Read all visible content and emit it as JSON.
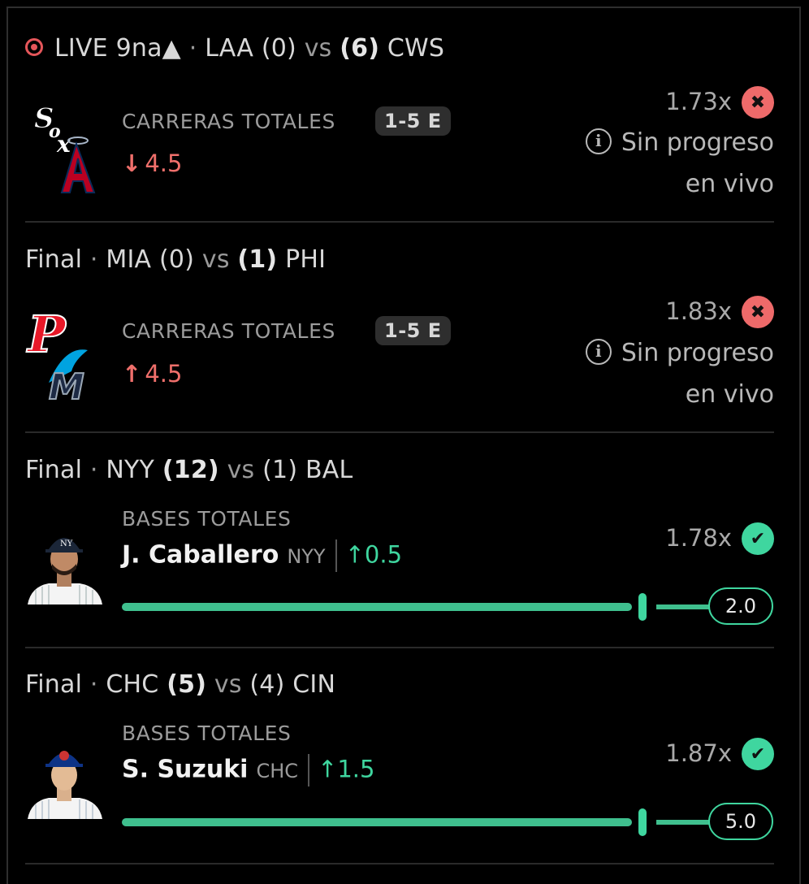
{
  "bets": [
    {
      "status_label": "LIVE 9na▲",
      "sep": "·",
      "away_team": "LAA",
      "away_score": "(0)",
      "vs": "vs",
      "home_score": "(6)",
      "home_team": "CWS",
      "market": "CARRERAS TOTALES",
      "badge": "1-5 E",
      "pick_arrow": "↓",
      "pick_value": "4.5",
      "multiplier": "1.73x",
      "result": "lost",
      "info_line1": "Sin progreso",
      "info_line2": "en vivo",
      "logos": [
        "white-sox-logo",
        "angels-logo"
      ]
    },
    {
      "status_label": "Final",
      "sep": "·",
      "away_team": "MIA",
      "away_score": "(0)",
      "vs": "vs",
      "home_score": "(1)",
      "home_team": "PHI",
      "market": "CARRERAS TOTALES",
      "badge": "1-5 E",
      "pick_arrow": "↑",
      "pick_value": "4.5",
      "multiplier": "1.83x",
      "result": "lost",
      "info_line1": "Sin progreso",
      "info_line2": "en vivo",
      "logos": [
        "phillies-logo",
        "marlins-logo"
      ]
    },
    {
      "status_label": "Final",
      "sep": "·",
      "away_team": "NYY",
      "away_score": "(12)",
      "vs": "vs",
      "home_score": "(1)",
      "home_team": "BAL",
      "market": "BASES TOTALES",
      "player": "J. Caballero",
      "player_team": "NYY",
      "pick_arrow": "↑",
      "pick_value": "0.5",
      "multiplier": "1.78x",
      "result": "won",
      "progress_value": "2.0"
    },
    {
      "status_label": "Final",
      "sep": "·",
      "away_team": "CHC",
      "away_score": "(5)",
      "vs": "vs",
      "home_score": "(4)",
      "home_team": "CIN",
      "market": "BASES TOTALES",
      "player": "S. Suzuki",
      "player_team": "CHC",
      "pick_arrow": "↑",
      "pick_value": "1.5",
      "multiplier": "1.87x",
      "result": "won",
      "progress_value": "5.0"
    }
  ],
  "colors": {
    "lost": "#ee6a6a",
    "won": "#3fd69f",
    "live": "#e5565a"
  }
}
